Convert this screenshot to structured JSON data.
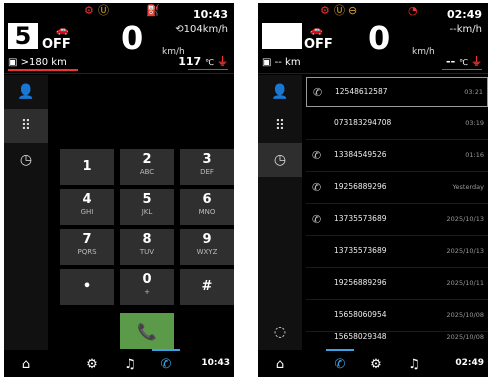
{
  "left": {
    "warnings": [
      "⚙",
      "Ⓤ",
      "⛽"
    ],
    "gear": "5",
    "drive_state": "OFF",
    "speed": "0",
    "speed_unit": "km/h",
    "clock": "10:43",
    "range_text": "104km/h",
    "range_prefix": "⟲",
    "odometer": ">180 km",
    "temp_value": "117",
    "temp_unit": "℃",
    "temp_icon": "⏚",
    "keypad": [
      {
        "digit": "1",
        "letters": ""
      },
      {
        "digit": "2",
        "letters": "ABC"
      },
      {
        "digit": "3",
        "letters": "DEF"
      },
      {
        "digit": "4",
        "letters": "GHI"
      },
      {
        "digit": "5",
        "letters": "JKL"
      },
      {
        "digit": "6",
        "letters": "MNO"
      },
      {
        "digit": "7",
        "letters": "PQRS"
      },
      {
        "digit": "8",
        "letters": "TUV"
      },
      {
        "digit": "9",
        "letters": "WXYZ"
      },
      {
        "digit": "•",
        "letters": ""
      },
      {
        "digit": "0",
        "letters": "+"
      },
      {
        "digit": "#",
        "letters": ""
      }
    ],
    "bottom_clock": "10:43"
  },
  "right": {
    "warnings": [
      "⚙",
      "Ⓤ",
      "⊖",
      "◔"
    ],
    "gear": "",
    "drive_state": "OFF",
    "speed": "0",
    "speed_unit": "km/h",
    "clock": "02:49",
    "range_text": "--km/h",
    "odometer": "-- km",
    "temp_value": "--",
    "temp_unit": "℃",
    "temp_icon": "⏚",
    "call_log": [
      {
        "number": "12548612587",
        "time": "03:21",
        "icon": true
      },
      {
        "number": "073183294708",
        "time": "03:19",
        "icon": false
      },
      {
        "number": "13384549526",
        "time": "01:16",
        "icon": true
      },
      {
        "number": "19256889296",
        "time": "Yesterday",
        "icon": true
      },
      {
        "number": "13735573689",
        "time": "2025/10/13",
        "icon": true
      },
      {
        "number": "13735573689",
        "time": "2025/10/13",
        "icon": false
      },
      {
        "number": "19256889296",
        "time": "2025/10/11",
        "icon": false
      },
      {
        "number": "15658060954",
        "time": "2025/10/08",
        "icon": false
      },
      {
        "number": "15658029348",
        "time": "2025/10/08",
        "icon": false
      }
    ],
    "bottom_clock": "02:49"
  },
  "colors": {
    "accent": "#3aa3e6",
    "call_green": "#5a9a49",
    "warning_red": "#e33333",
    "warning_amber": "#d9a52a"
  }
}
